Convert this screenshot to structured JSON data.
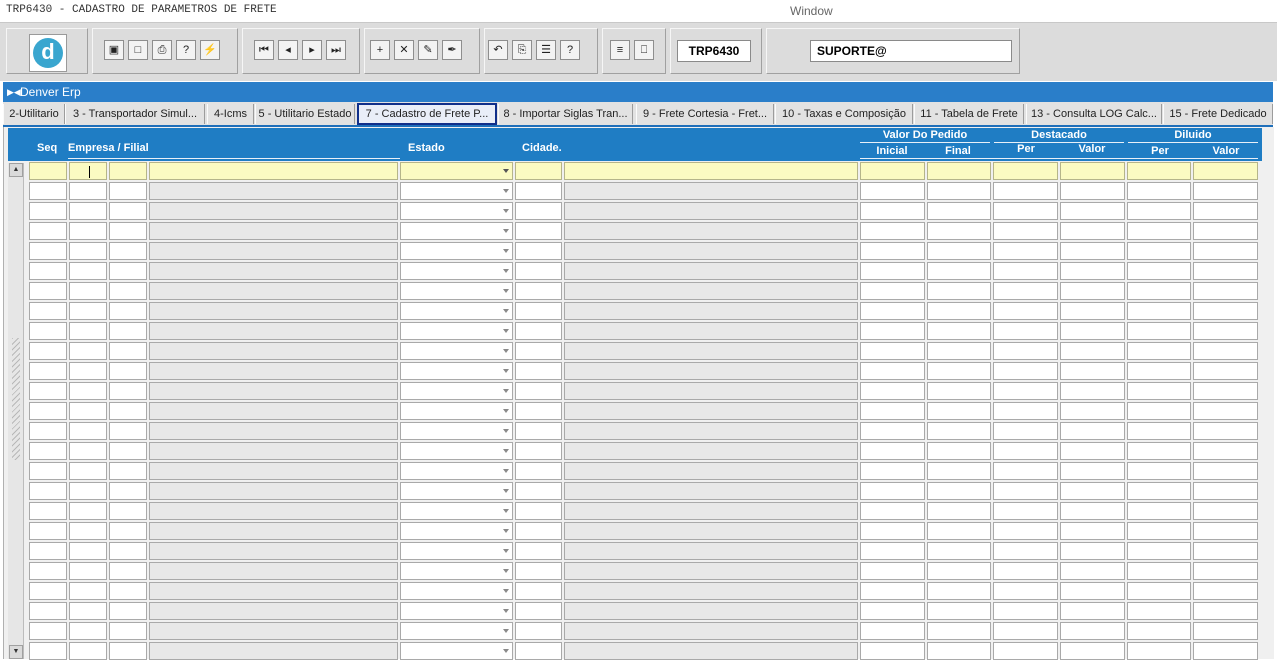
{
  "window": {
    "title": "TRP6430 - CADASTRO DE PARAMETROS DE FRETE",
    "menu_label": "Window"
  },
  "toolbar": {
    "module_code": "TRP6430",
    "user": "SUPORTE@",
    "buttons": [
      {
        "name": "save-icon",
        "glyph": "▣"
      },
      {
        "name": "clear-form-icon",
        "glyph": "□"
      },
      {
        "name": "print-icon",
        "glyph": "⎙"
      },
      {
        "name": "help-query-icon",
        "glyph": "?"
      },
      {
        "name": "execute-query-icon",
        "glyph": "⚡"
      },
      {
        "name": "first-record-icon",
        "glyph": "⏮"
      },
      {
        "name": "previous-record-icon",
        "glyph": "◂"
      },
      {
        "name": "next-record-icon",
        "glyph": "▸"
      },
      {
        "name": "last-record-icon",
        "glyph": "⏭"
      },
      {
        "name": "insert-record-icon",
        "glyph": "+"
      },
      {
        "name": "delete-record-icon",
        "glyph": "✕"
      },
      {
        "name": "edit-record-icon",
        "glyph": "✎"
      },
      {
        "name": "duplicate-record-icon",
        "glyph": "✒"
      },
      {
        "name": "undo-icon",
        "glyph": "↶"
      },
      {
        "name": "clipboard-icon",
        "glyph": "⎘"
      },
      {
        "name": "list-values-icon",
        "glyph": "☰"
      },
      {
        "name": "help-icon",
        "glyph": "?"
      },
      {
        "name": "menu-icon",
        "glyph": "≡"
      },
      {
        "name": "exit-icon",
        "glyph": "⎕"
      }
    ]
  },
  "app": {
    "title": "Denver Erp"
  },
  "tabs": [
    {
      "label": "2-Utilitario"
    },
    {
      "label": "3 - Transportador Simul..."
    },
    {
      "label": "4-Icms"
    },
    {
      "label": "5 - Utilitario Estado"
    },
    {
      "label": "7 - Cadastro de Frete P...",
      "active": true
    },
    {
      "label": "8 - Importar Siglas Tran..."
    },
    {
      "label": "9 - Frete Cortesia - Fret..."
    },
    {
      "label": "10 - Taxas e Composição"
    },
    {
      "label": "11 - Tabela de Frete"
    },
    {
      "label": "13 - Consulta LOG Calc..."
    },
    {
      "label": "15 - Frete Dedicado"
    }
  ],
  "grid": {
    "headers": {
      "seq": "Seq",
      "empresa_filial": "Empresa / Filial",
      "estado": "Estado",
      "cidade": "Cidade.",
      "valor_pedido": "Valor Do Pedido",
      "inicial": "Inicial",
      "final": "Final",
      "destacado": "Destacado",
      "diluido": "Diluido",
      "per": "Per",
      "valor": "Valor"
    },
    "row_count": 25,
    "current_row": 0
  },
  "colors": {
    "header_bg": "#1f7dc4",
    "current_row": "#fbfbc2",
    "readonly_cell": "#e8e8e8"
  }
}
